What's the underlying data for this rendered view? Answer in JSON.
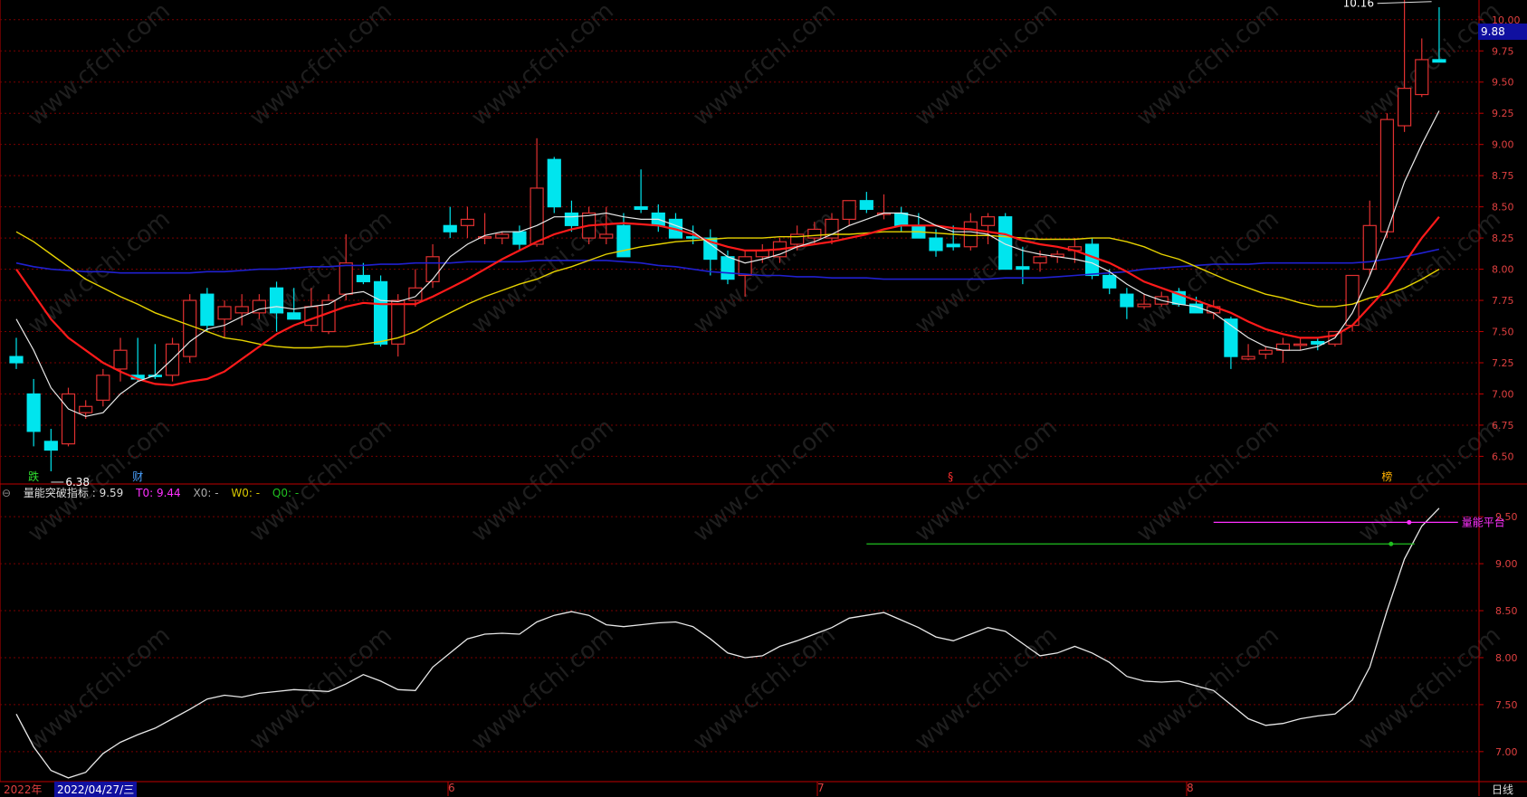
{
  "watermark": "www.cfchi.com",
  "colors": {
    "up": "#e03030",
    "down": "#00e5ee",
    "ma5": "#e8e8e8",
    "ma10": "#ff1a1a",
    "ma20": "#e6d200",
    "ma60": "#2020d0",
    "grid": "#7a0000",
    "axis": "#c00000"
  },
  "price_tag": "9.88",
  "markers": {
    "high": "10.16",
    "low": "6.38"
  },
  "events": [
    {
      "label": "跌",
      "color": "#30e030",
      "idx": 1
    },
    {
      "label": "财",
      "color": "#4aa0ff",
      "idx": 7
    },
    {
      "label": "§",
      "color": "#ff3030",
      "idx": 54
    },
    {
      "label": "榜",
      "color": "#ffb000",
      "idx": 79
    }
  ],
  "indicator": {
    "name": "量能突破指标 : 9.59",
    "t0": "T0: 9.44",
    "x0": "X0: -",
    "w0": "W0: -",
    "q0": "Q0: -",
    "platform_label": "量能平台"
  },
  "x_axis": {
    "year": "2022年",
    "date": "2022/04/27/三",
    "months": [
      "6",
      "7",
      "8"
    ],
    "period": "日线"
  },
  "chart_data": [
    {
      "type": "candlestick",
      "ylim": [
        6.3,
        10.1
      ],
      "yticks": [
        "6.50",
        "6.75",
        "7.00",
        "7.25",
        "7.50",
        "7.75",
        "8.00",
        "8.25",
        "8.50",
        "8.75",
        "9.00",
        "9.25",
        "9.50",
        "9.75",
        "10.00"
      ],
      "ohlc": [
        [
          7.3,
          7.45,
          7.2,
          7.25
        ],
        [
          7.0,
          7.12,
          6.58,
          6.7
        ],
        [
          6.62,
          6.72,
          6.38,
          6.55
        ],
        [
          6.6,
          7.05,
          6.58,
          7.0
        ],
        [
          6.85,
          6.95,
          6.8,
          6.9
        ],
        [
          6.95,
          7.2,
          6.9,
          7.15
        ],
        [
          7.2,
          7.45,
          7.1,
          7.35
        ],
        [
          7.15,
          7.45,
          7.1,
          7.12
        ],
        [
          7.15,
          7.4,
          7.12,
          7.14
        ],
        [
          7.15,
          7.45,
          7.1,
          7.4
        ],
        [
          7.3,
          7.8,
          7.25,
          7.75
        ],
        [
          7.8,
          7.85,
          7.5,
          7.55
        ],
        [
          7.6,
          7.75,
          7.45,
          7.7
        ],
        [
          7.65,
          7.8,
          7.55,
          7.7
        ],
        [
          7.65,
          7.8,
          7.6,
          7.75
        ],
        [
          7.85,
          7.9,
          7.5,
          7.65
        ],
        [
          7.65,
          7.85,
          7.6,
          7.6
        ],
        [
          7.55,
          7.85,
          7.5,
          7.7
        ],
        [
          7.5,
          7.8,
          7.48,
          7.75
        ],
        [
          7.8,
          8.28,
          7.75,
          8.05
        ],
        [
          7.95,
          8.05,
          7.88,
          7.9
        ],
        [
          7.9,
          7.95,
          7.38,
          7.4
        ],
        [
          7.4,
          7.8,
          7.3,
          7.75
        ],
        [
          7.75,
          8.0,
          7.7,
          7.85
        ],
        [
          7.9,
          8.2,
          7.85,
          8.1
        ],
        [
          8.35,
          8.5,
          8.25,
          8.3
        ],
        [
          8.35,
          8.5,
          8.25,
          8.4
        ],
        [
          8.25,
          8.45,
          8.2,
          8.26
        ],
        [
          8.25,
          8.3,
          8.2,
          8.28
        ],
        [
          8.3,
          8.35,
          8.15,
          8.2
        ],
        [
          8.2,
          9.05,
          8.18,
          8.65
        ],
        [
          8.88,
          8.9,
          8.45,
          8.5
        ],
        [
          8.45,
          8.55,
          8.3,
          8.35
        ],
        [
          8.25,
          8.5,
          8.2,
          8.45
        ],
        [
          8.25,
          8.5,
          8.2,
          8.28
        ],
        [
          8.35,
          8.45,
          8.1,
          8.1
        ],
        [
          8.5,
          8.8,
          8.45,
          8.48
        ],
        [
          8.45,
          8.52,
          8.3,
          8.35
        ],
        [
          8.4,
          8.45,
          8.25,
          8.25
        ],
        [
          8.26,
          8.35,
          8.2,
          8.25
        ],
        [
          8.25,
          8.32,
          7.95,
          8.08
        ],
        [
          8.1,
          8.15,
          7.88,
          7.92
        ],
        [
          7.95,
          8.15,
          7.78,
          8.1
        ],
        [
          8.1,
          8.2,
          8.05,
          8.15
        ],
        [
          8.1,
          8.25,
          8.05,
          8.22
        ],
        [
          8.2,
          8.35,
          8.15,
          8.28
        ],
        [
          8.25,
          8.38,
          8.2,
          8.32
        ],
        [
          8.25,
          8.45,
          8.2,
          8.4
        ],
        [
          8.4,
          8.55,
          8.35,
          8.55
        ],
        [
          8.55,
          8.62,
          8.45,
          8.48
        ],
        [
          8.45,
          8.6,
          8.4,
          8.45
        ],
        [
          8.45,
          8.5,
          8.3,
          8.35
        ],
        [
          8.35,
          8.45,
          8.25,
          8.25
        ],
        [
          8.25,
          8.32,
          8.1,
          8.15
        ],
        [
          8.2,
          8.35,
          8.15,
          8.18
        ],
        [
          8.18,
          8.45,
          8.15,
          8.38
        ],
        [
          8.35,
          8.45,
          8.2,
          8.42
        ],
        [
          8.42,
          8.45,
          8.0,
          8.0
        ],
        [
          8.02,
          8.18,
          7.88,
          8.0
        ],
        [
          8.05,
          8.15,
          7.98,
          8.1
        ],
        [
          8.1,
          8.15,
          8.05,
          8.12
        ],
        [
          8.15,
          8.25,
          8.05,
          8.18
        ],
        [
          8.2,
          8.25,
          7.92,
          7.95
        ],
        [
          7.95,
          8.0,
          7.8,
          7.85
        ],
        [
          7.8,
          7.85,
          7.6,
          7.7
        ],
        [
          7.7,
          7.8,
          7.68,
          7.72
        ],
        [
          7.72,
          7.82,
          7.7,
          7.78
        ],
        [
          7.82,
          7.85,
          7.7,
          7.72
        ],
        [
          7.72,
          7.78,
          7.65,
          7.65
        ],
        [
          7.65,
          7.75,
          7.6,
          7.7
        ],
        [
          7.6,
          7.62,
          7.2,
          7.3
        ],
        [
          7.28,
          7.4,
          7.27,
          7.3
        ],
        [
          7.32,
          7.38,
          7.28,
          7.35
        ],
        [
          7.35,
          7.45,
          7.25,
          7.4
        ],
        [
          7.4,
          7.45,
          7.35,
          7.4
        ],
        [
          7.42,
          7.45,
          7.35,
          7.4
        ],
        [
          7.4,
          7.5,
          7.38,
          7.5
        ],
        [
          7.55,
          7.95,
          7.5,
          7.95
        ],
        [
          8.0,
          8.55,
          7.95,
          8.35
        ],
        [
          8.3,
          9.25,
          8.25,
          9.2
        ],
        [
          9.15,
          10.16,
          9.1,
          9.45
        ],
        [
          9.4,
          9.85,
          9.38,
          9.68
        ],
        [
          9.68,
          10.1,
          9.68,
          9.66
        ]
      ],
      "ma5": [
        7.6,
        7.35,
        7.05,
        6.88,
        6.82,
        6.85,
        7.0,
        7.1,
        7.15,
        7.28,
        7.42,
        7.52,
        7.55,
        7.62,
        7.68,
        7.7,
        7.68,
        7.7,
        7.72,
        7.8,
        7.82,
        7.75,
        7.74,
        7.78,
        7.92,
        8.1,
        8.2,
        8.27,
        8.3,
        8.3,
        8.35,
        8.42,
        8.42,
        8.43,
        8.45,
        8.42,
        8.4,
        8.4,
        8.35,
        8.3,
        8.2,
        8.1,
        8.05,
        8.08,
        8.12,
        8.18,
        8.22,
        8.28,
        8.35,
        8.4,
        8.45,
        8.45,
        8.42,
        8.35,
        8.3,
        8.3,
        8.28,
        8.2,
        8.15,
        8.12,
        8.1,
        8.08,
        8.05,
        7.98,
        7.88,
        7.8,
        7.75,
        7.72,
        7.7,
        7.65,
        7.55,
        7.45,
        7.38,
        7.35,
        7.35,
        7.38,
        7.45,
        7.65,
        7.95,
        8.3,
        8.7,
        9.0,
        9.27
      ],
      "ma10": [
        8.0,
        7.8,
        7.6,
        7.45,
        7.35,
        7.25,
        7.18,
        7.12,
        7.08,
        7.07,
        7.1,
        7.12,
        7.18,
        7.28,
        7.38,
        7.48,
        7.55,
        7.6,
        7.65,
        7.7,
        7.73,
        7.72,
        7.72,
        7.72,
        7.78,
        7.85,
        7.92,
        8.0,
        8.08,
        8.15,
        8.22,
        8.28,
        8.32,
        8.35,
        8.36,
        8.37,
        8.36,
        8.35,
        8.32,
        8.28,
        8.22,
        8.18,
        8.15,
        8.15,
        8.16,
        8.18,
        8.2,
        8.22,
        8.25,
        8.28,
        8.32,
        8.35,
        8.35,
        8.35,
        8.33,
        8.32,
        8.3,
        8.28,
        8.23,
        8.2,
        8.18,
        8.15,
        8.1,
        8.05,
        7.98,
        7.9,
        7.85,
        7.8,
        7.75,
        7.7,
        7.65,
        7.58,
        7.52,
        7.48,
        7.45,
        7.45,
        7.47,
        7.55,
        7.7,
        7.85,
        8.05,
        8.25,
        8.42
      ],
      "ma20": [
        8.3,
        8.22,
        8.12,
        8.02,
        7.92,
        7.85,
        7.78,
        7.72,
        7.65,
        7.6,
        7.55,
        7.5,
        7.45,
        7.43,
        7.4,
        7.38,
        7.37,
        7.37,
        7.38,
        7.38,
        7.4,
        7.42,
        7.45,
        7.5,
        7.58,
        7.65,
        7.72,
        7.78,
        7.83,
        7.88,
        7.92,
        7.98,
        8.02,
        8.07,
        8.12,
        8.15,
        8.18,
        8.2,
        8.22,
        8.23,
        8.24,
        8.25,
        8.25,
        8.25,
        8.26,
        8.26,
        8.27,
        8.28,
        8.28,
        8.29,
        8.3,
        8.3,
        8.3,
        8.29,
        8.28,
        8.27,
        8.27,
        8.26,
        8.25,
        8.24,
        8.24,
        8.24,
        8.25,
        8.25,
        8.22,
        8.18,
        8.12,
        8.08,
        8.02,
        7.96,
        7.9,
        7.85,
        7.8,
        7.77,
        7.73,
        7.7,
        7.7,
        7.72,
        7.77,
        7.8,
        7.85,
        7.92,
        8.0
      ],
      "ma60": [
        8.05,
        8.02,
        8.0,
        7.99,
        7.98,
        7.98,
        7.97,
        7.97,
        7.97,
        7.97,
        7.97,
        7.98,
        7.98,
        7.99,
        8.0,
        8.0,
        8.01,
        8.02,
        8.02,
        8.03,
        8.03,
        8.04,
        8.04,
        8.05,
        8.05,
        8.05,
        8.06,
        8.06,
        8.06,
        8.06,
        8.07,
        8.07,
        8.07,
        8.07,
        8.07,
        8.06,
        8.05,
        8.03,
        8.02,
        8.0,
        7.98,
        7.97,
        7.96,
        7.95,
        7.95,
        7.94,
        7.94,
        7.93,
        7.93,
        7.93,
        7.92,
        7.92,
        7.92,
        7.92,
        7.92,
        7.92,
        7.92,
        7.93,
        7.93,
        7.93,
        7.94,
        7.95,
        7.96,
        7.97,
        7.98,
        8.0,
        8.01,
        8.02,
        8.03,
        8.04,
        8.04,
        8.04,
        8.05,
        8.05,
        8.05,
        8.05,
        8.05,
        8.05,
        8.06,
        8.08,
        8.1,
        8.13,
        8.16
      ]
    },
    {
      "type": "line",
      "name": "量能突破指标",
      "ylim": [
        6.7,
        9.8
      ],
      "yticks": [
        "7.00",
        "7.50",
        "8.00",
        "8.50",
        "9.00",
        "9.50"
      ],
      "values": [
        7.4,
        7.05,
        6.8,
        6.72,
        6.78,
        6.98,
        7.1,
        7.18,
        7.25,
        7.35,
        7.45,
        7.56,
        7.6,
        7.58,
        7.62,
        7.64,
        7.66,
        7.65,
        7.64,
        7.72,
        7.82,
        7.75,
        7.66,
        7.65,
        7.9,
        8.05,
        8.2,
        8.25,
        8.26,
        8.25,
        8.38,
        8.45,
        8.49,
        8.45,
        8.35,
        8.33,
        8.35,
        8.37,
        8.38,
        8.33,
        8.2,
        8.05,
        8.0,
        8.02,
        8.12,
        8.18,
        8.25,
        8.32,
        8.42,
        8.45,
        8.48,
        8.4,
        8.32,
        8.22,
        8.18,
        8.25,
        8.32,
        8.28,
        8.15,
        8.02,
        8.05,
        8.12,
        8.05,
        7.95,
        7.8,
        7.75,
        7.74,
        7.75,
        7.7,
        7.65,
        7.5,
        7.35,
        7.28,
        7.3,
        7.35,
        7.38,
        7.4,
        7.55,
        7.9,
        8.5,
        9.05,
        9.4,
        9.59
      ],
      "platform": {
        "value": 9.44,
        "from_idx": 69,
        "to_idx": 81
      },
      "support": {
        "value": 9.21,
        "from_idx": 49,
        "to_idx": 81
      }
    }
  ]
}
